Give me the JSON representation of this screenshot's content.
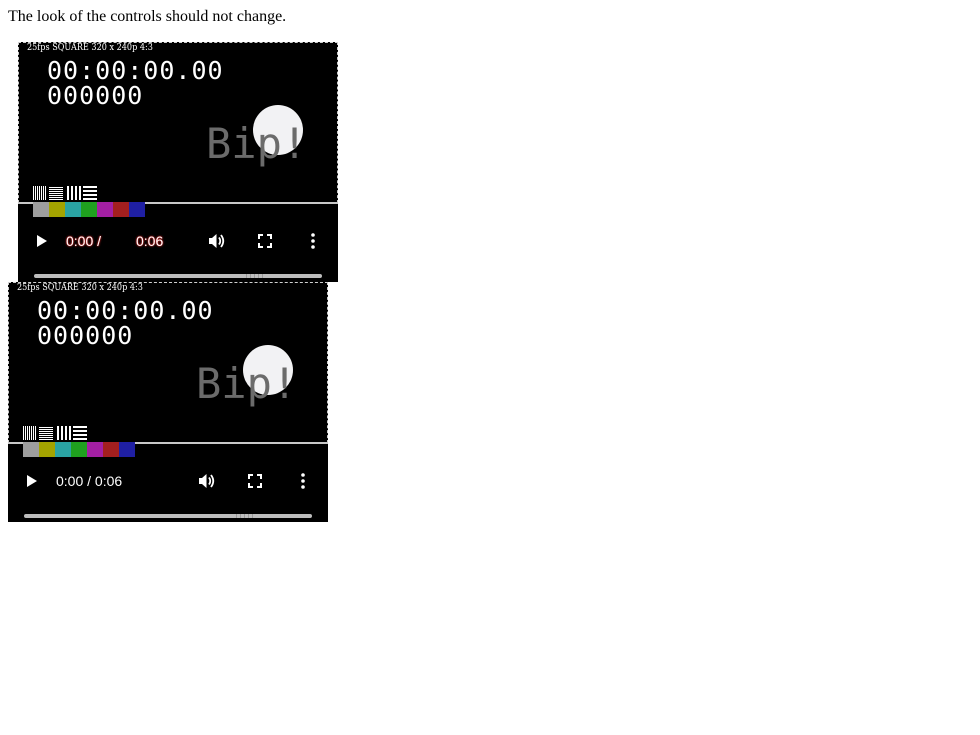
{
  "caption": "The look of the controls should not change.",
  "colors": {
    "page_background": "#ffffff",
    "video_background": "#000000",
    "circle": "#f2f2f4",
    "bip_text": "#6b6b6b",
    "time_glow_player1": "#ff3030",
    "color_bars": [
      "#9e9e9e",
      "#a3a300",
      "#2aa3a3",
      "#1fa01f",
      "#a31fa3",
      "#a31f1f",
      "#1f1fa3"
    ]
  },
  "players": [
    {
      "video": {
        "info_text": "25fps SQUARE 320 x 240p 4:3",
        "timecode": "00:00:00.00",
        "frame_count": "000000",
        "bip_text": "Bip!"
      },
      "controls": {
        "current_time": "0:00 /",
        "duration": "0:06",
        "play_icon": "play-icon",
        "volume_icon": "volume-icon",
        "fullscreen_icon": "fullscreen-icon",
        "more_icon": "more-options-icon",
        "progress": 0
      }
    },
    {
      "video": {
        "info_text": "25fps SQUARE 320 x 240p 4:3",
        "timecode": "00:00:00.00",
        "frame_count": "000000",
        "bip_text": "Bip!"
      },
      "controls": {
        "time_display": "0:00 / 0:06",
        "play_icon": "play-icon",
        "volume_icon": "volume-icon",
        "fullscreen_icon": "fullscreen-icon",
        "more_icon": "more-options-icon",
        "progress": 0
      }
    }
  ]
}
